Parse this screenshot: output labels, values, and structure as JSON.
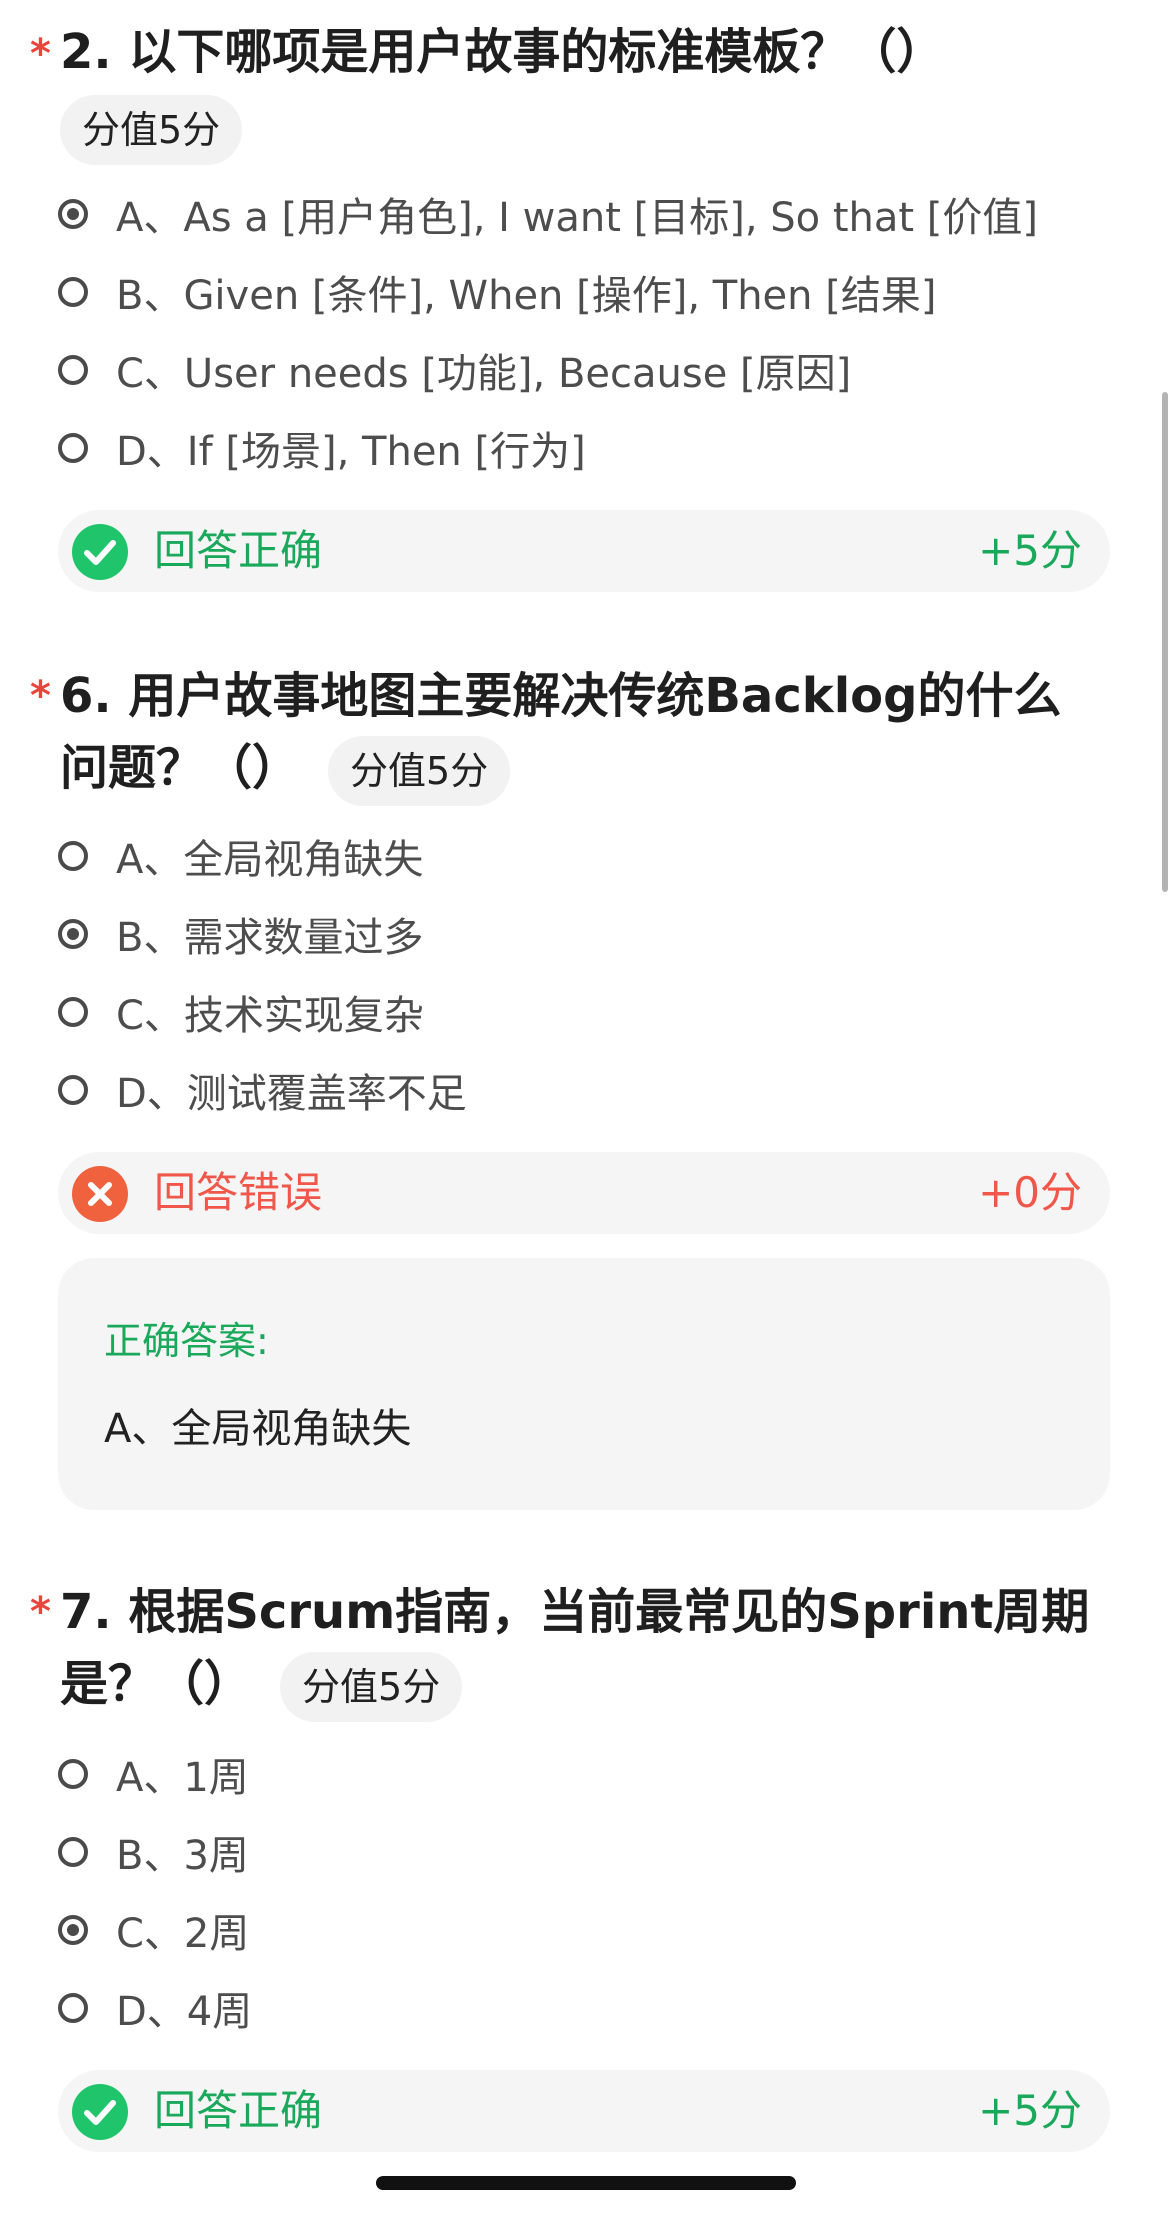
{
  "questions": [
    {
      "star": "*",
      "title": "2. 以下哪项是用户故事的标准模板？（）",
      "score_label": "分值5分",
      "options": [
        {
          "label": "A、As a [用户角色], I want [目标], So that [价值]",
          "selected": true
        },
        {
          "label": "B、Given [条件], When [操作], Then [结果]",
          "selected": false
        },
        {
          "label": "C、User needs [功能], Because [原因]",
          "selected": false
        },
        {
          "label": "D、If [场景], Then [行为]",
          "selected": false
        }
      ],
      "result": {
        "status": "correct",
        "text": "回答正确",
        "score": "+5分",
        "icon": "check-circle-icon"
      }
    },
    {
      "star": "*",
      "title_line1": "6. 用户故事地图主要解决传统Backlog的什么",
      "title_line2": "问题？（）",
      "score_label": "分值5分",
      "options": [
        {
          "label": "A、全局视角缺失",
          "selected": false
        },
        {
          "label": "B、需求数量过多",
          "selected": true
        },
        {
          "label": "C、技术实现复杂",
          "selected": false
        },
        {
          "label": "D、测试覆盖率不足",
          "selected": false
        }
      ],
      "result": {
        "status": "wrong",
        "text": "回答错误",
        "score": "+0分",
        "icon": "x-circle-icon"
      },
      "correct_answer": {
        "label": "正确答案:",
        "value": "A、全局视角缺失"
      }
    },
    {
      "star": "*",
      "title_line1": "7. 根据Scrum指南，当前最常见的Sprint周期",
      "title_line2": "是？（）",
      "score_label": "分值5分",
      "options": [
        {
          "label": "A、1周",
          "selected": false
        },
        {
          "label": "B、3周",
          "selected": false
        },
        {
          "label": "C、2周",
          "selected": true
        },
        {
          "label": "D、4周",
          "selected": false
        }
      ],
      "result": {
        "status": "correct",
        "text": "回答正确",
        "score": "+5分",
        "icon": "check-circle-icon"
      }
    }
  ],
  "colors": {
    "correct": "#1aa85b",
    "wrong": "#f0574a",
    "required_star": "#e8453c"
  }
}
